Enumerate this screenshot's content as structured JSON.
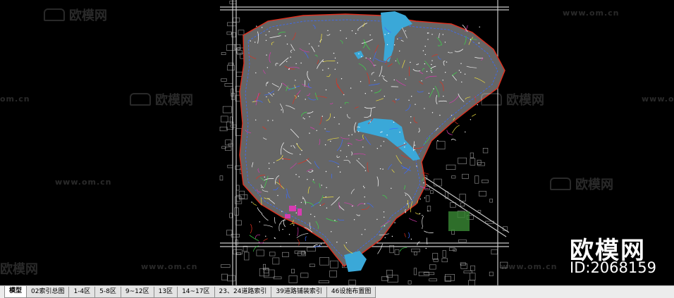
{
  "watermark": {
    "site": "www.om.cn",
    "site_partial": "om.cn",
    "brand": "欧模网",
    "big_brand": "欧模网",
    "big_id": "ID:2068159"
  },
  "tabs": [
    {
      "label": "模型",
      "active": true
    },
    {
      "label": "02索引总图"
    },
    {
      "label": "1-4区"
    },
    {
      "label": "5-8区"
    },
    {
      "label": "9~12区"
    },
    {
      "label": "13区"
    },
    {
      "label": "14~17区"
    },
    {
      "label": "23、24道路索引"
    },
    {
      "label": "39道路铺装索引"
    },
    {
      "label": "46设施布置图"
    }
  ],
  "colors": {
    "background": "#000000",
    "terrain": "#6b6b6b",
    "water": "#3aa8d8",
    "boundary": "#e0301e",
    "tabbar": "#ececec"
  },
  "icons": {
    "watermark_logo": "sofa-logo-icon"
  }
}
